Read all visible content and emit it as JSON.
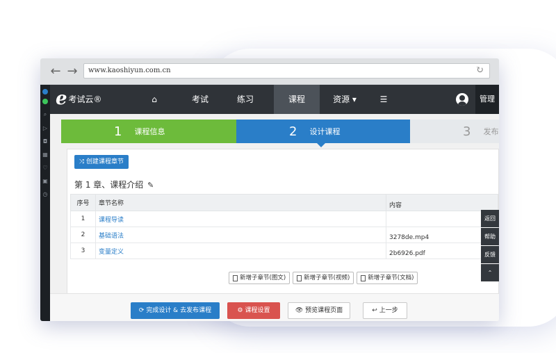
{
  "browser": {
    "url": "www.kaoshiyun.com.cn",
    "back_icon": "←",
    "forward_icon": "→",
    "reload_icon": "↻"
  },
  "app": {
    "logo_letter": "e",
    "logo_text": "考试云®",
    "nav": [
      {
        "label": "⌂",
        "icon": "home-icon"
      },
      {
        "label": "考试"
      },
      {
        "label": "练习"
      },
      {
        "label": "课程"
      },
      {
        "label": "资源 ▾"
      },
      {
        "label": "☰",
        "icon": "list-icon"
      }
    ],
    "manage_label": "管理"
  },
  "steps": [
    {
      "num": "1",
      "label": "课程信息"
    },
    {
      "num": "2",
      "label": "设计课程"
    },
    {
      "num": "3",
      "label": "发布"
    }
  ],
  "panel": {
    "create_button": "⤨ 创建课程章节",
    "chapter_title": "第 1 章、课程介绍",
    "edit_icon": "✎",
    "table": {
      "headers": [
        "序号",
        "章节名称",
        "内容"
      ],
      "rows": [
        {
          "idx": "1",
          "name": "课程导读",
          "content": ""
        },
        {
          "idx": "2",
          "name": "基础语法",
          "content": "3278de.mp4"
        },
        {
          "idx": "3",
          "name": "变量定义",
          "content": "2b6926.pdf"
        }
      ]
    },
    "add_buttons": [
      "新增子章节(图文)",
      "新增子章节(视频)",
      "新增子章节(文档)"
    ]
  },
  "float_buttons": [
    "返回",
    "帮助",
    "反馈",
    "⌃"
  ],
  "footer": {
    "publish": "⟳ 完成设计 & 去发布课程",
    "settings": "⚙ 课程设置",
    "preview": "👁 预览课程页面",
    "back": "↩ 上一步"
  },
  "colors": {
    "nav_bg": "#2f3338",
    "step1": "#6dbb3b",
    "step2": "#2a7ec8",
    "danger": "#d9534f"
  }
}
